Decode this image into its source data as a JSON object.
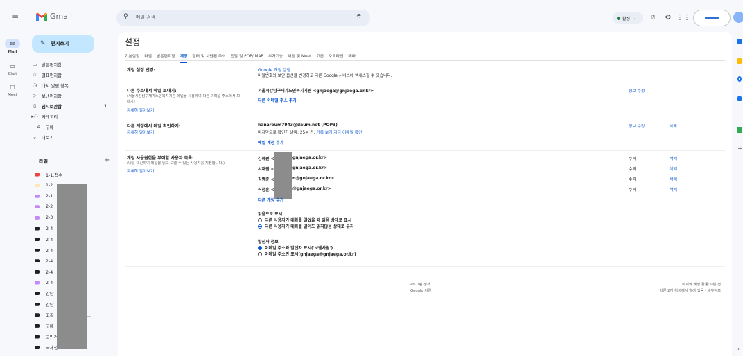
{
  "app": {
    "name": "Gmail"
  },
  "search": {
    "placeholder": "메일 검색"
  },
  "status": {
    "label": "활성"
  },
  "rail": [
    {
      "label": "Mail",
      "icon": "mail-icon"
    },
    {
      "label": "Chat",
      "icon": "chat-icon"
    },
    {
      "label": "Meet",
      "icon": "meet-icon"
    }
  ],
  "compose": {
    "label": "편지쓰기"
  },
  "nav": [
    {
      "label": "받은편지함",
      "icon": "inbox-icon",
      "count": ""
    },
    {
      "label": "별표편지함",
      "icon": "star-icon",
      "count": ""
    },
    {
      "label": "다시 알림 항목",
      "icon": "snooze-icon",
      "count": ""
    },
    {
      "label": "보낸편지함",
      "icon": "send-icon",
      "count": ""
    },
    {
      "label": "임시보관함",
      "icon": "draft-icon",
      "count": "1"
    },
    {
      "label": "카테고리",
      "icon": "category-icon",
      "count": ""
    },
    {
      "label": "구매",
      "icon": "purchase-icon",
      "count": ""
    },
    {
      "label": "더보기",
      "icon": "chevron-down-icon",
      "count": ""
    }
  ],
  "labels_header": {
    "title": "라벨",
    "add": "+"
  },
  "labels": [
    {
      "text": "1-1.접수",
      "color": "#e8453c"
    },
    {
      "text": "1-2",
      "color": "#fde9b1"
    },
    {
      "text": "2-1",
      "color": "#c58af9"
    },
    {
      "text": "2-2",
      "color": "#c58af9"
    },
    {
      "text": "2-3",
      "color": "#c58af9"
    },
    {
      "text": "2-4",
      "color": "#202124"
    },
    {
      "text": "2-4          김병준",
      "color": "#202124"
    },
    {
      "text": "2-4          김혜원",
      "color": "#202124"
    },
    {
      "text": "2-4          서재원",
      "color": "#202124"
    },
    {
      "text": "2-4          허정훈",
      "color": "#202124"
    },
    {
      "text": "2-4",
      "color": "#c58af9"
    },
    {
      "text": "강남                관",
      "color": "#202124"
    },
    {
      "text": "강남",
      "color": "#202124"
    },
    {
      "text": "고독               식대상...",
      "color": "#202124"
    },
    {
      "text": "구매",
      "color": "#202124"
    },
    {
      "text": "국민건강보험공단",
      "color": "#202124"
    },
    {
      "text": "국세청",
      "color": "#202124"
    }
  ],
  "settings": {
    "title": "설정",
    "tabs": [
      "기본설정",
      "라벨",
      "받은편지함",
      "계정",
      "필터 및 차단된 주소",
      "전달 및 POP/IMAP",
      "부가기능",
      "채팅 및 Meet",
      "고급",
      "오프라인",
      "테마"
    ],
    "active_tab": "계정",
    "sections": {
      "change_account": {
        "label": "계정 설정 변경:",
        "link": "Google 계정 설정",
        "desc": "비밀번호와 보안 옵션을 변경하고 다른 Google 서비스에 액세스할 수 있습니다."
      },
      "send_as": {
        "label": "다른 주소에서 메일 보내기:",
        "sub1": "(서울시강남구재가노인복지기관 메일을 사용하여 다른 이메일 주소에서 보",
        "sub2": "내기)",
        "learn": "자세히 알아보기",
        "address": "서울시강남구재가노인복지기관 <gnjaega@gnjaega.or.kr>",
        "add": "다른 이메일 주소 추가",
        "edit": "정보 수정"
      },
      "check_mail": {
        "label": "다른 계정에서 메일 확인하기:",
        "learn": "자세히 알아보기",
        "account": "hanareum7943@daum.net (POP3)",
        "last_checked": "마지막으로 확인한 날짜: 25분 전.",
        "view_history": "기록 보기",
        "check_now": "지금 이메일 확인",
        "add": "메일 계정 추가",
        "edit": "정보 수정",
        "delete": "삭제"
      },
      "grant_access": {
        "label": "계정 사용권한을 부여할 사용자 목록:",
        "sub": "(나를 대신하여 메일을 읽고 보낼 수 있는 사용자를 지정합니다.)",
        "learn": "자세히 알아보기",
        "users": [
          {
            "name": "김혜원 <",
            "email_tail": "gnjaega.or.kr>",
            "status": "수락",
            "action": "삭제"
          },
          {
            "name": "서재원 <",
            "email_tail": "gnjaega.or.kr>",
            "status": "수락",
            "action": "삭제"
          },
          {
            "name": "김병준 <",
            "email_tail": "n@gnjaega.or.kr>",
            "status": "수락",
            "action": "삭제"
          },
          {
            "name": "허정훈 <",
            "email_tail": "@gnjaega.or.kr>",
            "status": "수락",
            "action": "삭제"
          }
        ],
        "add": "다른 계정 추가",
        "read_title": "읽음으로 표시",
        "read_opt1": "다른 사용자가 대화를 열었을 때 읽음 상태로 표시",
        "read_opt2": "다른 사용자가 대화를 열어도 읽지않음 상태로 유지",
        "sender_title": "발신자 정보",
        "sender_opt1": "이메일 주소와 발신자 표시('보낸사람')",
        "sender_opt2": "이메일 주소만 표시(gnjaega@gnjaega.or.kr)"
      }
    },
    "footer": {
      "policy": "프로그램 정책",
      "support": "Google 지원",
      "activity": "마지막 계정 활동: 0분 전",
      "detail": "다른 2개 위치에서 열려 있음 · 세부정보"
    }
  },
  "colors": {
    "accent": "#0b57d0",
    "compose": "#c2e7ff",
    "background": "#f6f8fc"
  }
}
